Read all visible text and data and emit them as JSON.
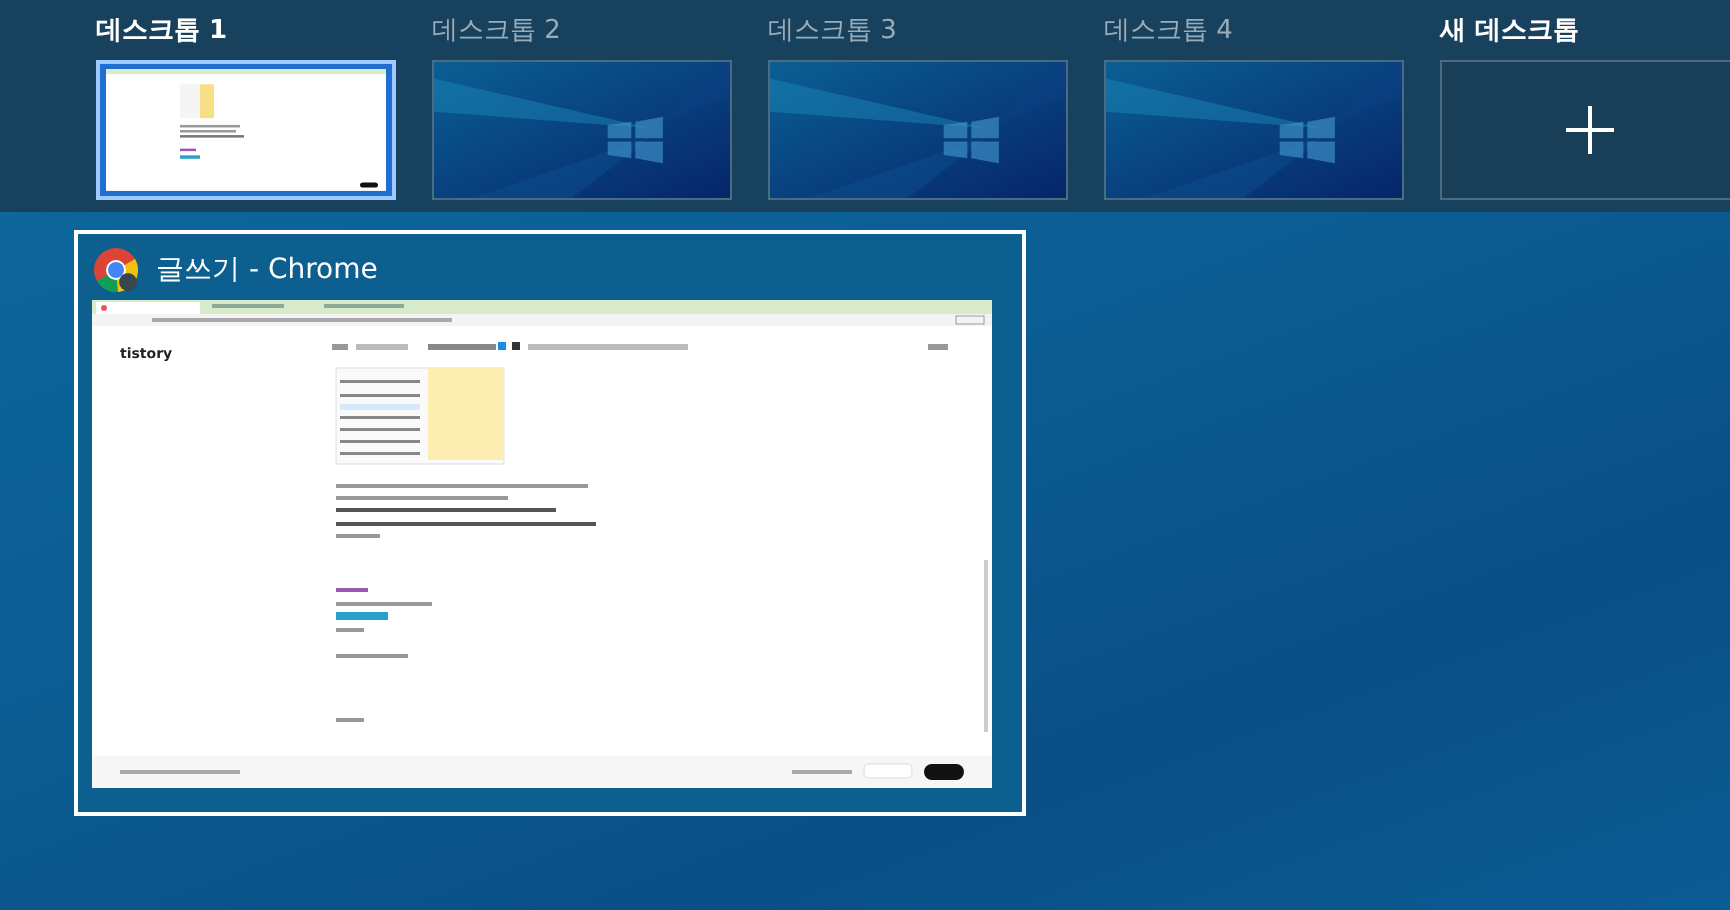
{
  "desktops": [
    {
      "label": "데스크톱 1",
      "selected": true,
      "kind": "screen"
    },
    {
      "label": "데스크톱 2",
      "selected": false,
      "kind": "wallpaper"
    },
    {
      "label": "데스크톱 3",
      "selected": false,
      "kind": "wallpaper"
    },
    {
      "label": "데스크톱 4",
      "selected": false,
      "kind": "wallpaper"
    }
  ],
  "new_desktop": {
    "label": "새 데스크톱"
  },
  "windows": [
    {
      "title": "글쓰기 - Chrome",
      "selected": true,
      "logo": "tistory"
    }
  ]
}
